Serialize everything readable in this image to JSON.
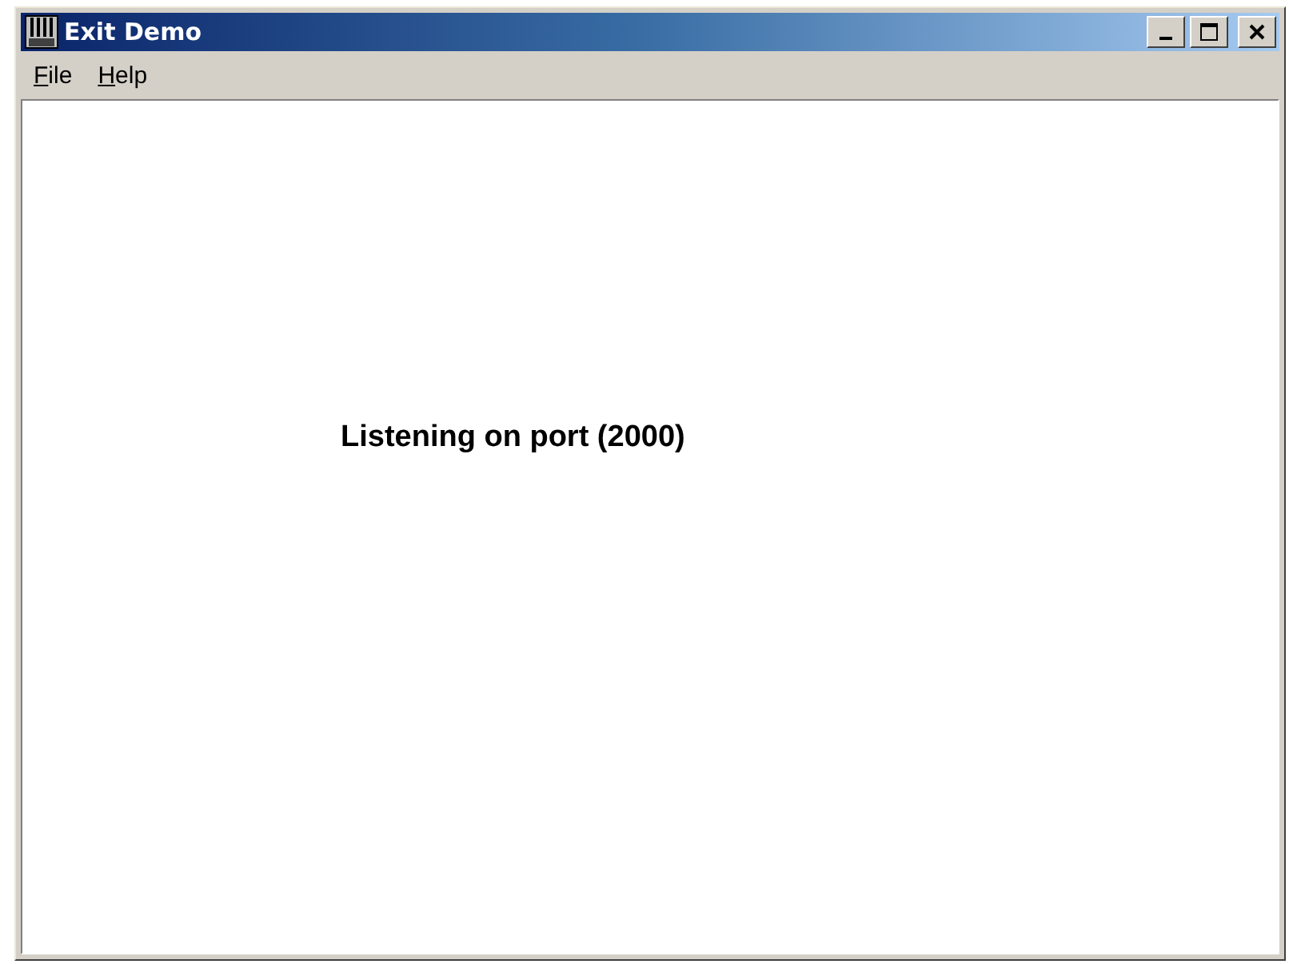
{
  "window": {
    "title": "Exit Demo"
  },
  "menu": [
    {
      "label": "File"
    },
    {
      "label": "Help"
    }
  ],
  "content": {
    "message": "Listening on port (2000)"
  }
}
